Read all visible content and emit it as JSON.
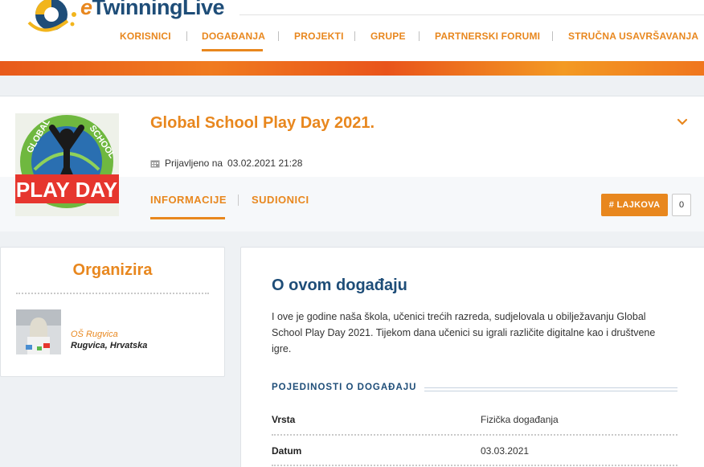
{
  "header": {
    "logo_text_prefix": "e",
    "logo_text_main": "Twinning",
    "logo_text_suffix": "Live",
    "nav": [
      {
        "label": "KORISNICI"
      },
      {
        "label": "DOGAĐANJA"
      },
      {
        "label": "PROJEKTI"
      },
      {
        "label": "GRUPE"
      },
      {
        "label": "PARTNERSKI FORUMI"
      },
      {
        "label": "STRUČNA USAVRŠAVANJA"
      }
    ],
    "active_nav": "DOGAĐANJA"
  },
  "event": {
    "title": "Global School Play Day 2021.",
    "image_text": {
      "top_left": "GLOBAL",
      "top_right": "SCHOOL",
      "main": "PLAY DAY"
    },
    "date_label": "Prijavljeno na",
    "date_value": "03.02.2021 21:28",
    "tabs": [
      {
        "label": "INFORMACIJE"
      },
      {
        "label": "SUDIONICI"
      }
    ],
    "like_label": "# LAJKOVA",
    "like_count": "0"
  },
  "organizer": {
    "title": "Organizira",
    "name": "OŠ Rugvica",
    "location": "Rugvica, Hrvatska"
  },
  "about": {
    "title": "O ovom događaju",
    "text": "I ove je godine naša škola, učenici trećih razreda, sudjelovala u obilježavanju Global School Play Day 2021. Tijekom dana učenici su igrali različite digitalne kao i društvene igre.",
    "details_heading": "POJEDINOSTI O DOGAĐAJU",
    "rows": [
      {
        "label": "Vrsta",
        "value": "Fizička događanja"
      },
      {
        "label": "Datum",
        "value": "03.03.2021"
      }
    ]
  },
  "colors": {
    "accent": "#e8871e",
    "navy": "#1e4d78",
    "background": "#eef1f4"
  }
}
